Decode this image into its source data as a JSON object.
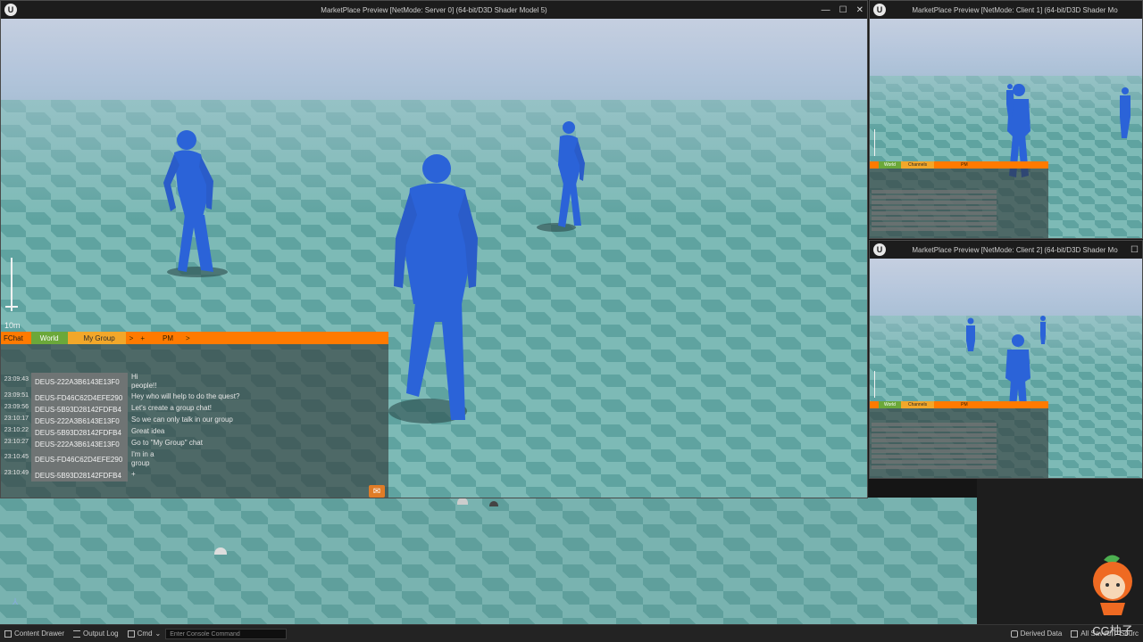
{
  "server_window": {
    "title": "MarketPlace Preview [NetMode: Server 0]  (64-bit/D3D Shader Model 5)",
    "scale_label": "10m",
    "chat": {
      "tabs": {
        "chat": "FChat",
        "world": "World",
        "group": "My Group",
        "arrow": ">",
        "plus": "+",
        "pm": "PM",
        "arrow2": ">"
      },
      "messages": [
        {
          "time": "23:09:43",
          "user": "DEUS-222A3B6143E13F0",
          "text": "Hi people!!"
        },
        {
          "time": "23:09:51",
          "user": "DEUS-FD46C62D4EFE290",
          "text": "Hey who will help to do the quest?"
        },
        {
          "time": "23:09:56",
          "user": "DEUS-5B93D28142FDFB4",
          "text": "Let's create a group chat!"
        },
        {
          "time": "23:10:17",
          "user": "DEUS-222A3B6143E13F0",
          "text": "So we can only talk in our group"
        },
        {
          "time": "23:10:22",
          "user": "DEUS-5B93D28142FDFB4",
          "text": "Great idea"
        },
        {
          "time": "23:10:27",
          "user": "DEUS-222A3B6143E13F0",
          "text": "Go to \"My Group\" chat"
        },
        {
          "time": "23:10:45",
          "user": "DEUS-FD46C62D4EFE290",
          "text": "I'm in a group"
        },
        {
          "time": "23:10:49",
          "user": "DEUS-5B93D28142FDFB4",
          "text": "+"
        }
      ]
    }
  },
  "client1_window": {
    "title": "MarketPlace Preview [NetMode: Client 1]  (64-bit/D3D Shader Mo",
    "tabs": {
      "world": "World",
      "group": "Channels",
      "pm": "PM"
    }
  },
  "client2_window": {
    "title": "MarketPlace Preview [NetMode: Client 2]  (64-bit/D3D Shader Mo",
    "tabs": {
      "world": "World",
      "group": "Channels",
      "pm": "PM"
    }
  },
  "status_bar": {
    "content_drawer": "Content Drawer",
    "output_log": "Output Log",
    "cmd": "Cmd",
    "console_placeholder": "Enter Console Command",
    "derived_data": "Derived Data",
    "all_saved": "All Saved",
    "source_control": "Sourc"
  },
  "watermark_text": "CG柚子",
  "colors": {
    "accent_orange": "#ff7a00",
    "world_tab": "#6ba83a",
    "character_blue": "#2b63d8"
  }
}
